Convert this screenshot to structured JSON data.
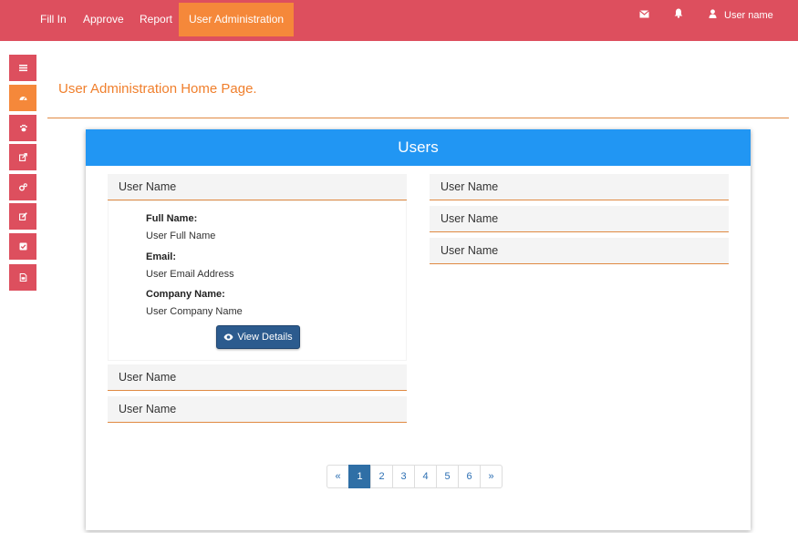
{
  "nav": {
    "items": [
      {
        "label": "Fill In"
      },
      {
        "label": "Approve"
      },
      {
        "label": "Report"
      },
      {
        "label": "User Administration"
      }
    ],
    "user_label": "User name",
    "icons": [
      "envelope-icon",
      "bell-icon",
      "user-icon"
    ]
  },
  "sidebar": {
    "icons": [
      "menu-icon",
      "dashboard-icon",
      "paw-icon",
      "external-link-icon",
      "cogs-icon",
      "edit-icon",
      "checkbox-icon",
      "pdf-file-icon"
    ],
    "active_index": 1
  },
  "page": {
    "title": "User Administration Home Page."
  },
  "users_panel": {
    "header": "Users",
    "left_column": [
      "User Name",
      "User Name",
      "User Name"
    ],
    "right_column": [
      "User Name",
      "User Name",
      "User Name"
    ],
    "expanded_details": {
      "full_name_label": "Full Name:",
      "full_name_value": "User Full Name",
      "email_label": "Email:",
      "email_value": "User Email Address",
      "company_label": "Company Name:",
      "company_value": "User Company Name",
      "view_button": "View Details"
    }
  },
  "pagination": {
    "prev": "«",
    "next": "»",
    "pages": [
      "1",
      "2",
      "3",
      "4",
      "5",
      "6"
    ],
    "current": "1"
  },
  "colors": {
    "navbar": "#dd4f5e",
    "accent_orange": "#f5883a",
    "panel_header": "#2196f3",
    "button": "#2c5b8e"
  }
}
